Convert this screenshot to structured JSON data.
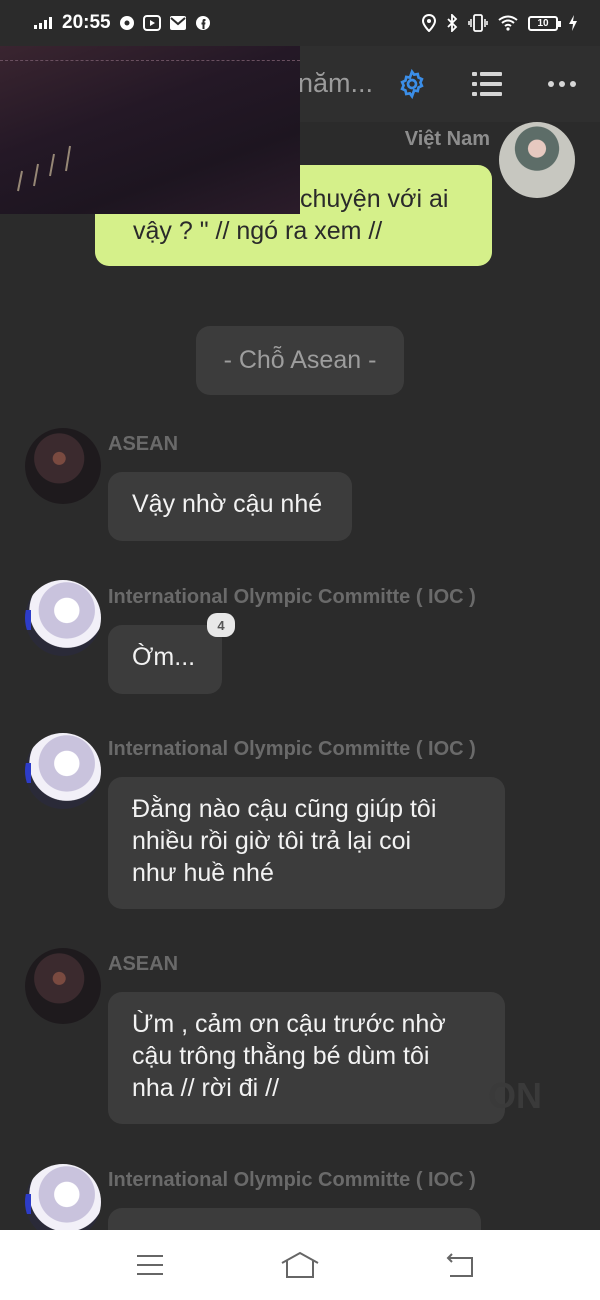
{
  "status_bar": {
    "time": "20:55",
    "battery": "10"
  },
  "header": {
    "title": "năm..."
  },
  "colors": {
    "accent": "#3b8ee8",
    "self_bubble": "#d5f08a",
    "bubble": "#3c3c3c",
    "background": "#2b2b2b"
  },
  "messages": [
    {
      "sender": "Việt Nam",
      "side": "right",
      "lines": [
        "chuyện với ai",
        "vậy ? \" // ngó ra xem //"
      ]
    },
    {
      "scene": "- Chỗ Asean -"
    },
    {
      "sender": "ASEAN",
      "lines": [
        "Vậy nhờ cậu nhé"
      ]
    },
    {
      "sender": "International Olympic Committe ( IOC )",
      "lines": [
        "Ờm..."
      ],
      "comments": "4"
    },
    {
      "sender": "International Olympic Committe ( IOC )",
      "lines": [
        "Đằng nào cậu cũng giúp tôi",
        "nhiều rồi giờ tôi trả lại coi",
        "như huề nhé"
      ]
    },
    {
      "sender": "ASEAN",
      "lines": [
        "Ừm , cảm ơn cậu trước nhờ",
        "cậu trông thằng bé dùm tôi",
        "nha // rời đi //"
      ]
    },
    {
      "sender": "International Olympic Committe ( IOC )",
      "lines": []
    }
  ],
  "watermark": "ON"
}
